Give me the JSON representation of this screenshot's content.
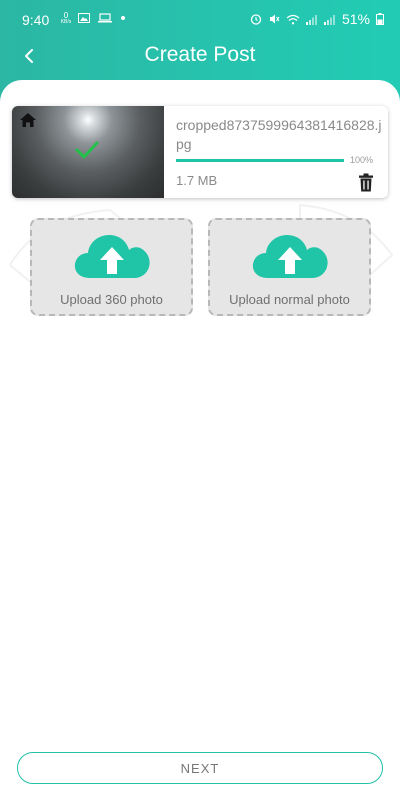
{
  "status_bar": {
    "time": "9:40",
    "net_speed_value": "0",
    "net_speed_unit": "KB/s",
    "battery": "51%"
  },
  "header": {
    "title": "Create Post"
  },
  "file": {
    "name": "cropped8737599964381416828.jpg",
    "progress_text": "100%",
    "progress": 1.0,
    "size": "1.7 MB"
  },
  "upload": {
    "option_360": "Upload 360 photo",
    "option_normal": "Upload normal photo"
  },
  "footer": {
    "next_label": "NEXT"
  },
  "colors": {
    "accent": "#23c2a7",
    "upload_icon": "#1fc5a6"
  },
  "icons": {
    "back": "chevron-left-icon",
    "home": "home-icon",
    "check": "checkmark-icon",
    "delete": "trash-icon",
    "cloud": "cloud-upload-icon"
  }
}
